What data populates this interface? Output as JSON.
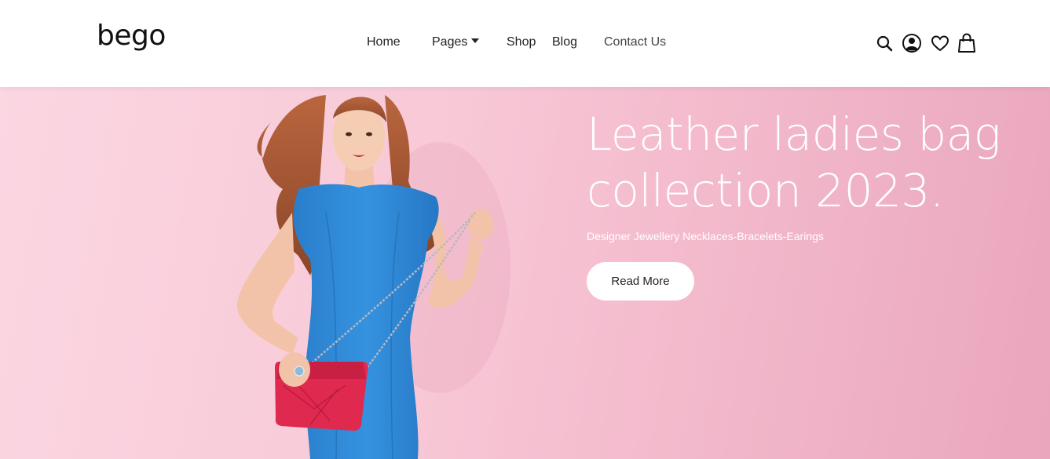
{
  "brand": {
    "logo": "bego"
  },
  "nav": {
    "items": [
      {
        "label": "Home"
      },
      {
        "label": "Pages"
      },
      {
        "label": "Shop"
      },
      {
        "label": "Blog"
      },
      {
        "label": "Contact Us"
      }
    ]
  },
  "header_icons": [
    "search-icon",
    "user-icon",
    "heart-icon",
    "shopping-bag-icon"
  ],
  "hero": {
    "title_line1": "Leather ladies bag",
    "title_line2": "collection 2023.",
    "subtitle": "Designer Jewellery Necklaces-Bracelets-Earings",
    "cta_label": "Read More",
    "background_color": "#f8c9d7",
    "dress_color": "#2f86d2",
    "bag_color": "#e0294f"
  }
}
